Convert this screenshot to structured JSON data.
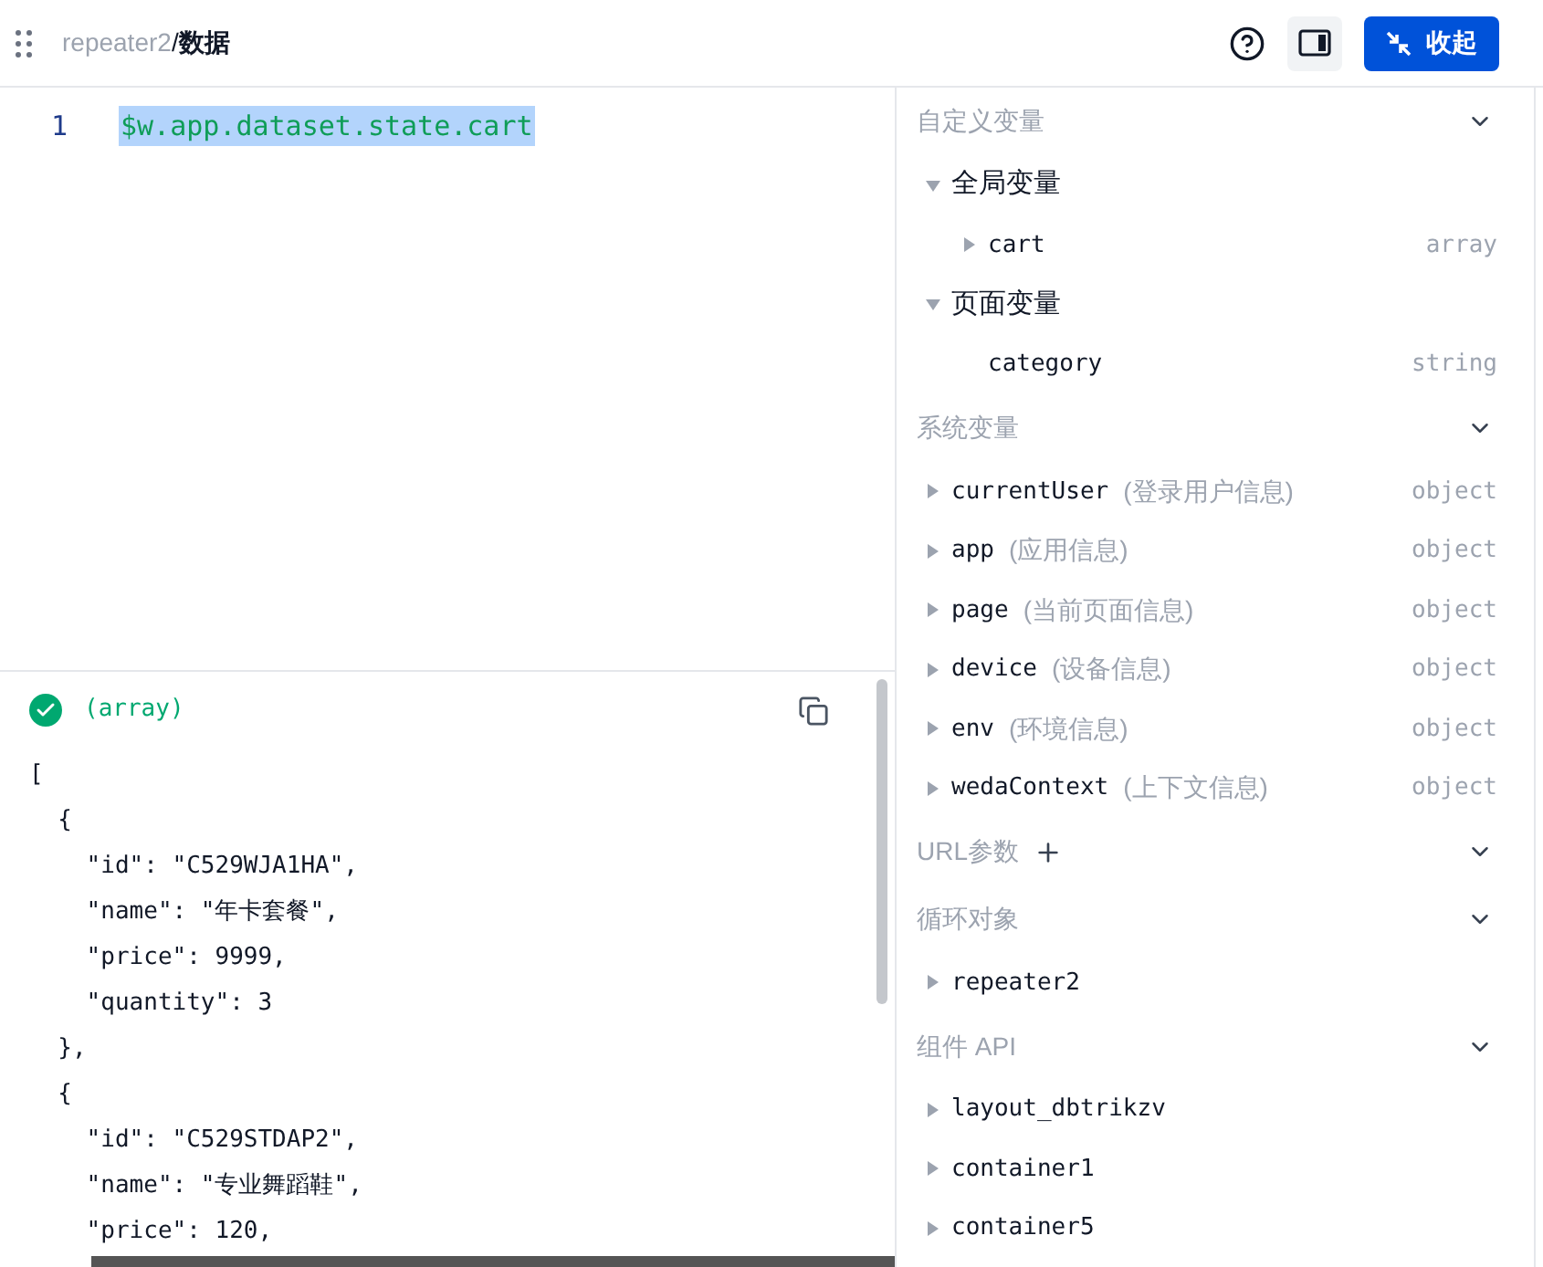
{
  "header": {
    "breadcrumb_parent": "repeater2",
    "separator": "/",
    "breadcrumb_current": "数据",
    "collapse_button": "收起"
  },
  "editor": {
    "lines": [
      {
        "number": "1",
        "code": "$w.app.dataset.state.cart",
        "selected": true
      }
    ]
  },
  "result": {
    "type_label": "(array)",
    "valid": true,
    "lines": [
      "[",
      "  {",
      "    \"id\": \"C529WJA1HA\",",
      "    \"name\": \"年卡套餐\",",
      "    \"price\": 9999,",
      "    \"quantity\": 3",
      "  },",
      "  {",
      "    \"id\": \"C529STDAP2\",",
      "    \"name\": \"专业舞蹈鞋\",",
      "    \"price\": 120,"
    ]
  },
  "sections": [
    {
      "title": "自定义变量",
      "expanded": true,
      "items": [
        {
          "label": "全局变量",
          "kind": "group",
          "expanded": true,
          "children": [
            {
              "name": "cart",
              "type": "array",
              "expandable": true
            }
          ]
        },
        {
          "label": "页面变量",
          "kind": "group",
          "expanded": true,
          "children": [
            {
              "name": "category",
              "type": "string",
              "expandable": false
            }
          ]
        }
      ]
    },
    {
      "title": "系统变量",
      "expanded": true,
      "items": [
        {
          "name": "currentUser",
          "note": "(登录用户信息)",
          "type": "object",
          "kind": "var",
          "expandable": true
        },
        {
          "name": "app",
          "note": "(应用信息)",
          "type": "object",
          "kind": "var",
          "expandable": true
        },
        {
          "name": "page",
          "note": "(当前页面信息)",
          "type": "object",
          "kind": "var",
          "expandable": true
        },
        {
          "name": "device",
          "note": "(设备信息)",
          "type": "object",
          "kind": "var",
          "expandable": true
        },
        {
          "name": "env",
          "note": "(环境信息)",
          "type": "object",
          "kind": "var",
          "expandable": true
        },
        {
          "name": "wedaContext",
          "note": "(上下文信息)",
          "type": "object",
          "kind": "var",
          "expandable": true
        }
      ]
    },
    {
      "title": "URL参数",
      "addable": true,
      "expanded": true
    },
    {
      "title": "循环对象",
      "expanded": true,
      "items": [
        {
          "name": "repeater2",
          "kind": "var",
          "expandable": true
        }
      ]
    },
    {
      "title": "组件 API",
      "expanded": true,
      "items": [
        {
          "name": "layout_dbtrikzv",
          "kind": "var",
          "expandable": true
        },
        {
          "name": "container1",
          "kind": "var",
          "expandable": true
        },
        {
          "name": "container5",
          "kind": "var",
          "expandable": true
        }
      ]
    }
  ]
}
